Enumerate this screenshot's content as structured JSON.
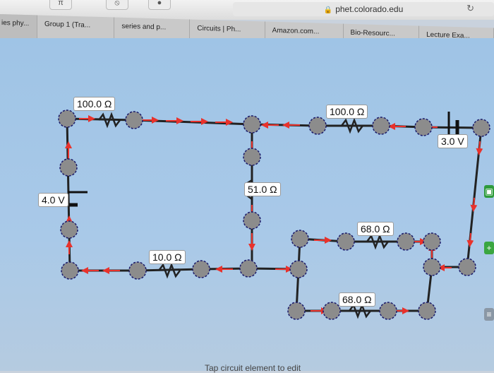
{
  "browser": {
    "url": "phet.colorado.edu",
    "tabs": [
      "ies phy...",
      "Group 1 (Tra...",
      "series and p...",
      "Circuits | Ph...",
      "Amazon.com...",
      "Bio-Resourc...",
      "Lecture Exa..."
    ]
  },
  "circuit": {
    "labels": {
      "r_top_left": "100.0 Ω",
      "r_top_right": "100.0 Ω",
      "battery_right": "3.0 V",
      "battery_left": "4.0 V",
      "r_middle": "51.0 Ω",
      "r_bottom_left": "10.0 Ω",
      "r_parallel_top": "68.0 Ω",
      "r_parallel_bottom": "68.0 Ω"
    }
  },
  "footer": {
    "hint": "Tap circuit element to edit"
  },
  "colors": {
    "wire": "#222222",
    "current_arrow": "#e8322c",
    "junction": "#8c8c8c",
    "junction_ring": "#1a1a6a"
  }
}
